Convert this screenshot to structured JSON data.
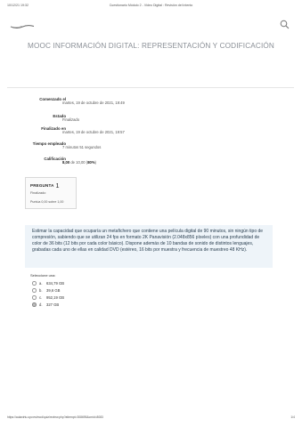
{
  "print_header": {
    "date": "10/12/21 19:32",
    "title": "Cuestionario Módulo 2 - Video Digital : Revisión del intento"
  },
  "course_title": "MOOC INFORMACIÓN DIGITAL: REPRESENTACIÓN Y CODIFICACIÓN",
  "summary": {
    "started_label": "Comenzado el",
    "started_value": "martes, 19 de octubre de 2021, 19:49",
    "state_label": "Estado",
    "state_value": "Finalizado",
    "finished_label": "Finalizado en",
    "finished_value": "martes, 19 de octubre de 2021, 19:57",
    "time_label": "Tiempo empleado",
    "time_value": "7 minutos 51 segundos",
    "grade_label": "Calificación",
    "grade_score": "8,00",
    "grade_rest": " de 10,00 (",
    "grade_percent": "80%",
    "grade_close": ")"
  },
  "question": {
    "label": "PREGUNTA",
    "number": "1",
    "status": "Finalizado",
    "points": "Puntúa 0,00 sobre 1,00",
    "text": "Estimar la capacidad que ocuparía un metafichero que contiene una película digital de 90 minutos, sin ningún tipo de compresión, sabiendo que se utilizan 24 fps en formato 2K Panavisión (2.048x856 píxeles) con una profundidad de color de 36 bits (12 bits por cada color básico). Dispone además de 10 bandas de sonido de distintos lenguajes, grabadas cada uno de ellas en calidad DVD (estéreo, 16 bits por muestra y frecuencia de muestreo 48 KHz).",
    "choose_label": "Seleccione una:",
    "options": [
      {
        "letter": "a.",
        "text": "634,79 GB"
      },
      {
        "letter": "b.",
        "text": "39,6 GB"
      },
      {
        "letter": "c.",
        "text": "952,19 GB"
      },
      {
        "letter": "d.",
        "text": "327 GB"
      }
    ]
  },
  "print_footer": {
    "url": "https://aulavirtu.upv.es/mod/quiz/review.php?attempt=308695&cmid=8083",
    "page": "1/4"
  },
  "icons": {
    "logo": "logo-swoosh",
    "search": "search-icon"
  }
}
